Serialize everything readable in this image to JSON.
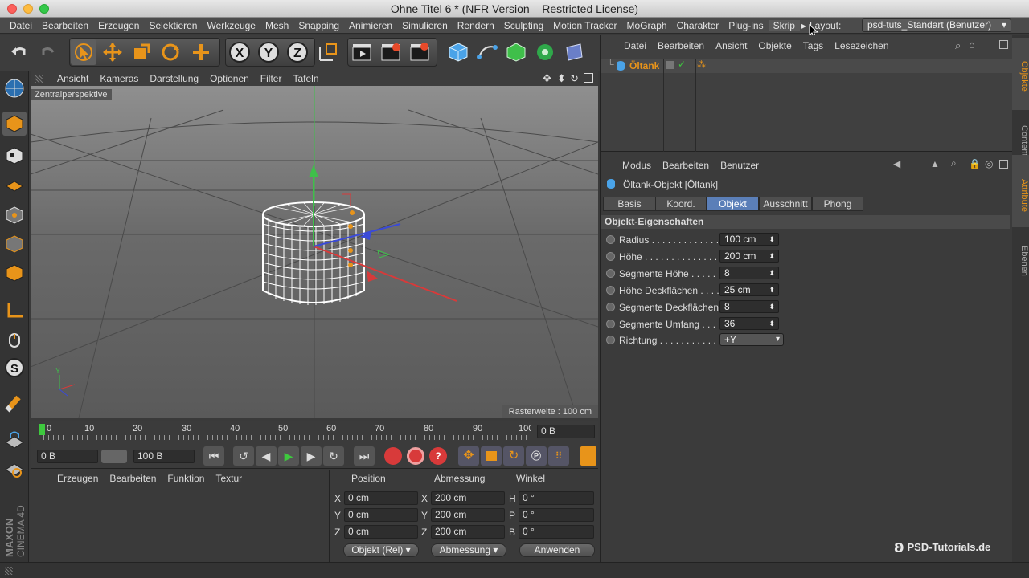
{
  "window": {
    "title": "Ohne Titel 6 * (NFR Version – Restricted License)"
  },
  "menubar": {
    "items": [
      "Datei",
      "Bearbeiten",
      "Erzeugen",
      "Selektieren",
      "Werkzeuge",
      "Mesh",
      "Snapping",
      "Animieren",
      "Simulieren",
      "Rendern",
      "Sculpting",
      "Motion Tracker",
      "MoGraph",
      "Charakter",
      "Plug-ins",
      "Skrip"
    ],
    "layout_label": "Layout:",
    "layout_value": "psd-tuts_Standart (Benutzer)"
  },
  "viewport": {
    "menu": [
      "Ansicht",
      "Kameras",
      "Darstellung",
      "Optionen",
      "Filter",
      "Tafeln"
    ],
    "camera_label": "Zentralperspektive",
    "grid_label": "Rasterweite : 100 cm"
  },
  "timeline": {
    "ticks": [
      "0",
      "10",
      "20",
      "30",
      "40",
      "50",
      "60",
      "70",
      "80",
      "90",
      "100"
    ],
    "end_frame": "0 B",
    "start_field": "0 B",
    "end_field": "100 B"
  },
  "materials": {
    "menu": [
      "Erzeugen",
      "Bearbeiten",
      "Funktion",
      "Textur"
    ]
  },
  "coords": {
    "headers": [
      "Position",
      "Abmessung",
      "Winkel"
    ],
    "rows": [
      {
        "a": "X",
        "pos": "0 cm",
        "b": "X",
        "size": "200 cm",
        "c": "H",
        "rot": "0 °"
      },
      {
        "a": "Y",
        "pos": "0 cm",
        "b": "Y",
        "size": "200 cm",
        "c": "P",
        "rot": "0 °"
      },
      {
        "a": "Z",
        "pos": "0 cm",
        "b": "Z",
        "size": "200 cm",
        "c": "B",
        "rot": "0 °"
      }
    ],
    "mode": "Objekt (Rel)",
    "size_mode": "Abmessung",
    "apply": "Anwenden"
  },
  "objects": {
    "menu": [
      "Datei",
      "Bearbeiten",
      "Ansicht",
      "Objekte",
      "Tags",
      "Lesezeichen"
    ],
    "items": [
      {
        "name": "Öltank"
      }
    ]
  },
  "attributes": {
    "menu": [
      "Modus",
      "Bearbeiten",
      "Benutzer"
    ],
    "object_title": "Öltank-Objekt [Öltank]",
    "tabs": [
      "Basis",
      "Koord.",
      "Objekt",
      "Ausschnitt",
      "Phong"
    ],
    "active_tab": "Objekt",
    "section": "Objekt-Eigenschaften",
    "props": [
      {
        "label": "Radius . . . . . . . . . . . . . .",
        "value": "100 cm"
      },
      {
        "label": "Höhe . . . . . . . . . . . . . . .",
        "value": "200 cm"
      },
      {
        "label": "Segmente Höhe . . . . . .",
        "value": "8"
      },
      {
        "label": "Höhe Deckflächen . . . .",
        "value": "25 cm"
      },
      {
        "label": "Segmente Deckflächen",
        "value": "8"
      },
      {
        "label": "Segmente Umfang . . . .",
        "value": "36"
      },
      {
        "label": "Richtung . . . . . . . . . . . .",
        "value": "+Y"
      }
    ]
  },
  "side_tabs": [
    "Objekte",
    "Content Bro",
    "Attribute",
    "Ebenen"
  ],
  "branding": {
    "maxon": "MAXON",
    "cinema": "CINEMA 4D",
    "watermark": "PSD-Tutorials.de"
  },
  "colors": {
    "accent": "#e8941a",
    "active_tab": "#5b7fb8",
    "timeline_marker": "#3ec93e"
  }
}
